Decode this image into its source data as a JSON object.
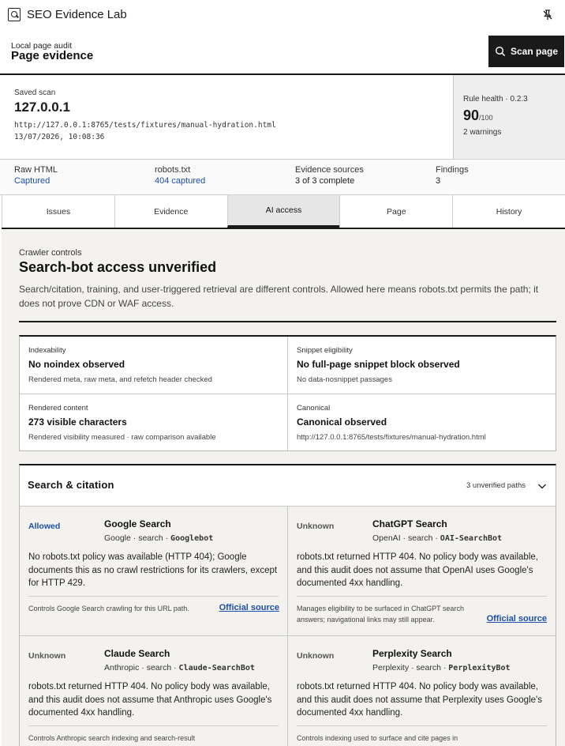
{
  "app": {
    "title": "SEO Evidence Lab",
    "icon": "document-search-icon",
    "pin_icon": "pin-off-icon"
  },
  "header": {
    "eyebrow": "Local page audit",
    "title": "Page evidence",
    "scan_button": "Scan page",
    "scan_icon": "search-icon"
  },
  "saved_scan": {
    "label": "Saved scan",
    "host": "127.0.0.1",
    "url": "http://127.0.0.1:8765/tests/fixtures/manual-hydration.html",
    "timestamp": "13/07/2026, 10:08:36"
  },
  "rule_health": {
    "label": "Rule health · 0.2.3",
    "score": "90",
    "score_max": "/100",
    "warnings": "2 warnings"
  },
  "stats": [
    {
      "label": "Raw HTML",
      "value": "Captured",
      "link": true
    },
    {
      "label": "robots.txt",
      "value": "404 captured",
      "link": true
    },
    {
      "label": "Evidence sources",
      "value": "3 of 3 complete",
      "link": false
    },
    {
      "label": "Findings",
      "value": "3",
      "link": false
    }
  ],
  "tabs": [
    {
      "label": "Issues",
      "active": false
    },
    {
      "label": "Evidence",
      "active": false
    },
    {
      "label": "AI access",
      "active": true
    },
    {
      "label": "Page",
      "active": false
    },
    {
      "label": "History",
      "active": false
    }
  ],
  "crawler": {
    "eyebrow": "Crawler controls",
    "title": "Search-bot access unverified",
    "description": "Search/citation, training, and user-triggered retrieval are different controls. Allowed here means robots.txt permits the path; it does not prove CDN or WAF access."
  },
  "signals": [
    {
      "label": "Indexability",
      "title": "No noindex observed",
      "sub": "Rendered meta, raw meta, and refetch header checked"
    },
    {
      "label": "Snippet eligibility",
      "title": "No full-page snippet block observed",
      "sub": "No data-nosnippet passages"
    },
    {
      "label": "Rendered content",
      "title": "273 visible characters",
      "sub": "Rendered visibility measured · raw comparison available"
    },
    {
      "label": "Canonical",
      "title": "Canonical observed",
      "sub": "http://127.0.0.1:8765/tests/fixtures/manual-hydration.html"
    }
  ],
  "search_citation": {
    "title": "Search & citation",
    "count": "3 unverified paths",
    "chevron_icon": "chevron-down-icon",
    "bots": [
      {
        "status": "Allowed",
        "name": "Google Search",
        "meta": "Google · search · ",
        "agent": "Googlebot",
        "body": "No robots.txt policy was available (HTTP 404); Google documents this as no crawl restrictions for its crawlers, except for HTTP 429.",
        "note": "Controls Google Search crawling for this URL path.",
        "link": "Official source"
      },
      {
        "status": "Unknown",
        "name": "ChatGPT Search",
        "meta": "OpenAI · search · ",
        "agent": "OAI-SearchBot",
        "body": "robots.txt returned HTTP 404. No policy body was available, and this audit does not assume that OpenAI uses Google's documented 4xx handling.",
        "note": "Manages eligibility to be surfaced in ChatGPT search answers; navigational links may still appear.",
        "link": "Official source"
      },
      {
        "status": "Unknown",
        "name": "Claude Search",
        "meta": "Anthropic · search · ",
        "agent": "Claude-SearchBot",
        "body": "robots.txt returned HTTP 404. No policy body was available, and this audit does not assume that Anthropic uses Google's documented 4xx handling.",
        "note": "Controls Anthropic search indexing and search-result",
        "link": ""
      },
      {
        "status": "Unknown",
        "name": "Perplexity Search",
        "meta": "Perplexity · search · ",
        "agent": "PerplexityBot",
        "body": "robots.txt returned HTTP 404. No policy body was available, and this audit does not assume that Perplexity uses Google's documented 4xx handling.",
        "note": "Controls indexing used to surface and cite pages in",
        "link": ""
      }
    ]
  }
}
